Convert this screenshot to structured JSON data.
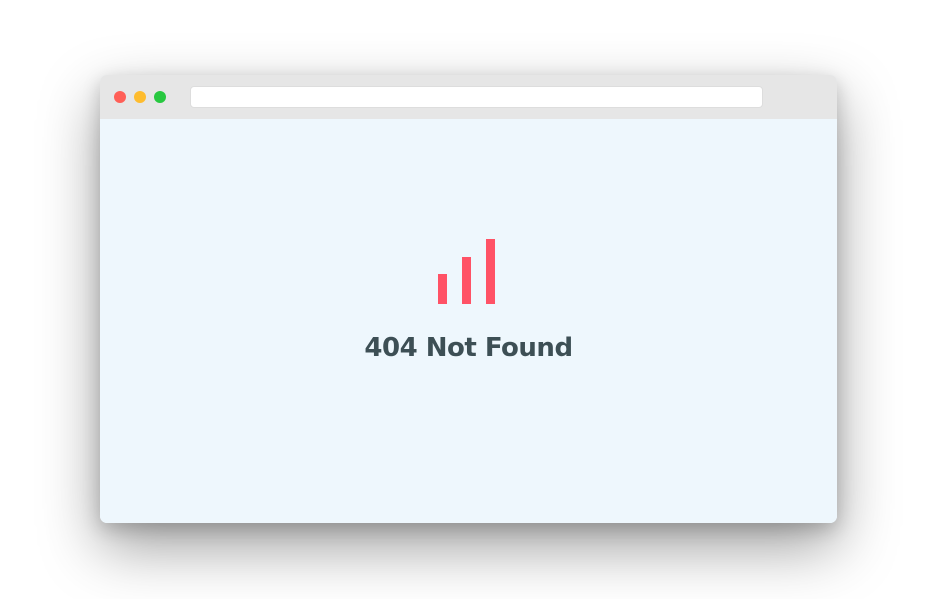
{
  "browser": {
    "address_value": "",
    "window_controls": {
      "close_color": "#ff5f57",
      "minimize_color": "#febc2e",
      "maximize_color": "#28c840"
    }
  },
  "content": {
    "icon": {
      "name": "signal-bars-icon",
      "color": "#ff5266",
      "bar_levels": [
        0.46,
        0.72,
        1.0
      ]
    },
    "error_message": "404 Not Found"
  }
}
